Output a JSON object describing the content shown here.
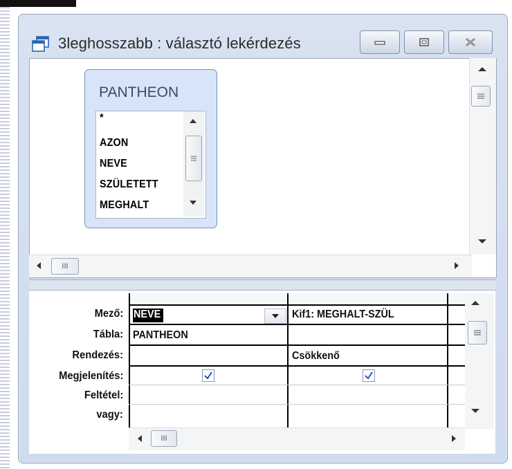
{
  "window": {
    "title": "3leghosszabb : választó lekérdezés"
  },
  "table_box": {
    "title": "PANTHEON",
    "fields": [
      "*",
      "AZON",
      "NEVE",
      "SZÜLETETT",
      "MEGHALT"
    ]
  },
  "grid": {
    "row_labels": [
      "Mező:",
      "Tábla:",
      "Rendezés:",
      "Megjelenítés:",
      "Feltétel:",
      "vagy:"
    ],
    "columns": [
      {
        "field": "NEVE",
        "table": "PANTHEON",
        "sort": "",
        "show": true,
        "criteria": "",
        "or": ""
      },
      {
        "field": "Kif1: MEGHALT-SZÜL",
        "table": "",
        "sort": "Csökkenő",
        "show": true,
        "criteria": "",
        "or": ""
      }
    ]
  },
  "scroll_thumb_label": "III",
  "colors": {
    "window_bg": "#cfdbee",
    "table_box_bg": "#d8e5f8",
    "grid_lines": "#000000"
  }
}
